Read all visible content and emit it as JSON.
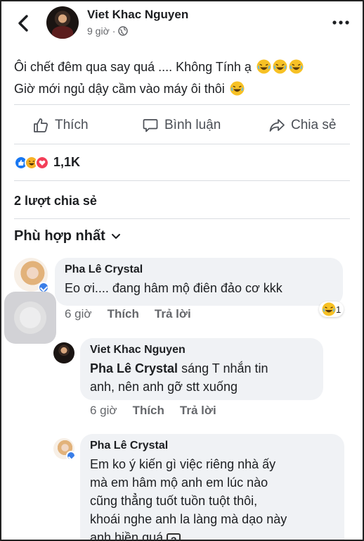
{
  "post": {
    "author": "Viet Khac Nguyen",
    "time": "9 giờ",
    "line1": "Ôi chết đêm qua say quá .... Không Tính ạ",
    "line2": "Giờ mới ngủ dậy cầm vào máy ôi thôi"
  },
  "actions": {
    "like": "Thích",
    "comment": "Bình luận",
    "share": "Chia sẻ"
  },
  "stats": {
    "reaction_count": "1,1K",
    "shares": "2 lượt chia sẻ"
  },
  "sort_label": "Phù hợp nhất",
  "comments": [
    {
      "name": "Pha Lê Crystal",
      "text": "Eo ơi.... đang hâm mộ điên đảo cơ kkk",
      "time": "6 giờ",
      "like": "Thích",
      "reply": "Trả lời",
      "reaction_count": "1"
    },
    {
      "name": "Viet Khac Nguyen",
      "tag": "Pha Lê Crystal",
      "text_after_tag": " sáng T nhắn tin",
      "text_line2": "anh, nên anh gỡ stt xuống",
      "time": "6 giờ",
      "like": "Thích",
      "reply": "Trả lời"
    },
    {
      "name": "Pha Lê Crystal",
      "lines": [
        "Em ko ý kiến gì việc riêng nhà ấy",
        "mà em hâm mộ anh em lúc nào",
        "cũng thẳng tuốt tuồn tuột thôi,",
        "khoái nghe anh la làng mà dạo này",
        "anh hiền quá"
      ],
      "tail_icon": "?"
    }
  ],
  "colors": {
    "text": "#1c1e21",
    "muted": "#65676b",
    "bubble": "#f0f2f5",
    "like_blue": "#1877f2",
    "love_red": "#f33e58",
    "haha_yellow": "#f7b125"
  },
  "icons": [
    "back-arrow-icon",
    "globe-icon",
    "more-icon",
    "like-icon",
    "comment-icon",
    "share-icon",
    "chevron-down-icon",
    "verified-icon",
    "haha-icon",
    "love-icon"
  ]
}
